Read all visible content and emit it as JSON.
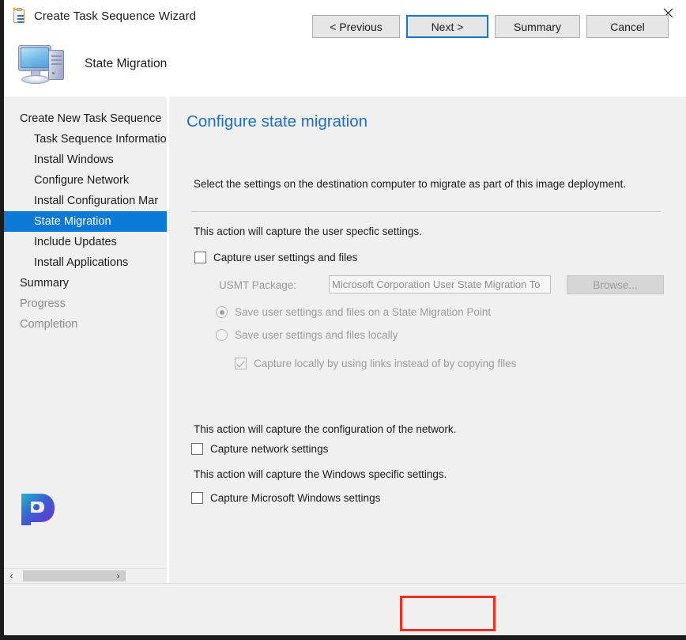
{
  "window": {
    "title": "Create Task Sequence Wizard",
    "title_icon": "clipboard-checklist-icon",
    "close_icon": "close-icon"
  },
  "header": {
    "icon": "computer-monitor-icon",
    "title": "State Migration"
  },
  "sidebar": {
    "items": [
      {
        "label": "Create New Task Sequence",
        "level": 0,
        "state": "normal"
      },
      {
        "label": "Task Sequence Informatio",
        "level": 1,
        "state": "normal"
      },
      {
        "label": "Install Windows",
        "level": 1,
        "state": "normal"
      },
      {
        "label": "Configure Network",
        "level": 1,
        "state": "normal"
      },
      {
        "label": "Install Configuration Mar",
        "level": 1,
        "state": "normal"
      },
      {
        "label": "State Migration",
        "level": 1,
        "state": "selected"
      },
      {
        "label": "Include Updates",
        "level": 1,
        "state": "normal"
      },
      {
        "label": "Install Applications",
        "level": 1,
        "state": "normal"
      },
      {
        "label": "Summary",
        "level": 0,
        "state": "normal"
      },
      {
        "label": "Progress",
        "level": 0,
        "state": "disabled"
      },
      {
        "label": "Completion",
        "level": 0,
        "state": "disabled"
      }
    ],
    "logo": "prajwal-p-logo",
    "scrollbar": {
      "left_arrow": "‹",
      "right_arrow": "›"
    },
    "selected_color": "#0a7ad6"
  },
  "content": {
    "page_title": "Configure state migration",
    "intro": "Select the settings on the destination computer to migrate as part of this image deployment.",
    "title_color": "#1f6fc4",
    "user_section": {
      "label": "This action will capture the user specfic settings.",
      "capture_user_checkbox": {
        "label": "Capture user settings and files",
        "checked": false,
        "enabled": true
      },
      "usmt_label": "USMT Package:",
      "usmt_value": "Microsoft Corporation User State Migration To",
      "usmt_enabled": false,
      "browse_label": "Browse...",
      "browse_enabled": false,
      "radio_smp": {
        "label": "Save user settings and files on a State Migration Point",
        "selected": true,
        "enabled": false
      },
      "radio_local": {
        "label": "Save user settings and files locally",
        "selected": false,
        "enabled": false
      },
      "capture_links_checkbox": {
        "label": "Capture locally by using links instead of by copying files",
        "checked": true,
        "enabled": false
      }
    },
    "network_section": {
      "label": "This action will capture the configuration of the network.",
      "checkbox": {
        "label": "Capture network settings",
        "checked": false,
        "enabled": true
      }
    },
    "windows_section": {
      "label": "This action will capture the Windows specific settings.",
      "checkbox": {
        "label": "Capture Microsoft Windows settings",
        "checked": false,
        "enabled": true
      }
    }
  },
  "footer": {
    "previous_label": "< Previous",
    "next_label": "Next >",
    "summary_label": "Summary",
    "cancel_label": "Cancel",
    "focused_button": "Next >",
    "focus_border_color": "#1878c8",
    "annotation_color": "#ee3124"
  }
}
